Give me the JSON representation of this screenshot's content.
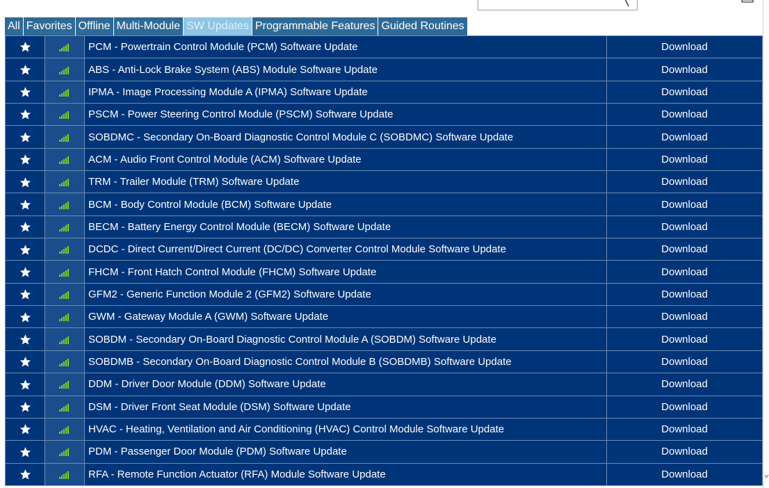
{
  "tabs": [
    {
      "label": "All",
      "active": false
    },
    {
      "label": "Favorites",
      "active": false
    },
    {
      "label": "Offline",
      "active": false
    },
    {
      "label": "Multi-Module",
      "active": false
    },
    {
      "label": "SW Updates",
      "active": true
    },
    {
      "label": "Programmable Features",
      "active": false
    },
    {
      "label": "Guided Routines",
      "active": false
    }
  ],
  "rows": [
    {
      "name": "PCM - Powertrain Control Module (PCM) Software Update",
      "action": "Download"
    },
    {
      "name": "ABS - Anti-Lock Brake System (ABS) Module Software Update",
      "action": "Download"
    },
    {
      "name": "IPMA - Image Processing Module A (IPMA) Software Update",
      "action": "Download"
    },
    {
      "name": "PSCM - Power Steering Control Module (PSCM) Software Update",
      "action": "Download"
    },
    {
      "name": "SOBDMC - Secondary On-Board Diagnostic Control Module C (SOBDMC) Software Update",
      "action": "Download"
    },
    {
      "name": "ACM - Audio Front Control Module (ACM) Software Update",
      "action": "Download"
    },
    {
      "name": "TRM - Trailer Module (TRM) Software Update",
      "action": "Download"
    },
    {
      "name": "BCM - Body Control Module (BCM) Software Update",
      "action": "Download"
    },
    {
      "name": "BECM - Battery Energy Control Module (BECM) Software Update",
      "action": "Download"
    },
    {
      "name": "DCDC - Direct Current/Direct Current (DC/DC) Converter Control Module Software Update",
      "action": "Download"
    },
    {
      "name": "FHCM - Front Hatch Control Module (FHCM) Software Update",
      "action": "Download"
    },
    {
      "name": "GFM2 - Generic Function Module 2 (GFM2) Software Update",
      "action": "Download"
    },
    {
      "name": "GWM - Gateway Module A (GWM) Software Update",
      "action": "Download"
    },
    {
      "name": "SOBDM - Secondary On-Board Diagnostic Control Module A (SOBDM) Software Update",
      "action": "Download"
    },
    {
      "name": "SOBDMB - Secondary On-Board Diagnostic Control Module B (SOBDMB) Software Update",
      "action": "Download"
    },
    {
      "name": "DDM - Driver Door Module (DDM) Software Update",
      "action": "Download"
    },
    {
      "name": "DSM - Driver Front Seat Module (DSM) Software Update",
      "action": "Download"
    },
    {
      "name": "HVAC - Heating, Ventilation and Air Conditioning (HVAC) Control Module Software Update",
      "action": "Download"
    },
    {
      "name": "PDM - Passenger Door Module (PDM) Software Update",
      "action": "Download"
    },
    {
      "name": "RFA - Remote Function Actuator (RFA) Module Software Update",
      "action": "Download"
    }
  ],
  "icons": {
    "favorite": "star-icon",
    "signal": "signal-strength-icon",
    "search": "search-icon"
  },
  "colors": {
    "row_background": "#003478",
    "signal_cell_background": "#1b4d8c",
    "tab_background": "#2e6a96",
    "tab_active_background": "#8fc6e6",
    "signal_green": "#7ed321"
  }
}
